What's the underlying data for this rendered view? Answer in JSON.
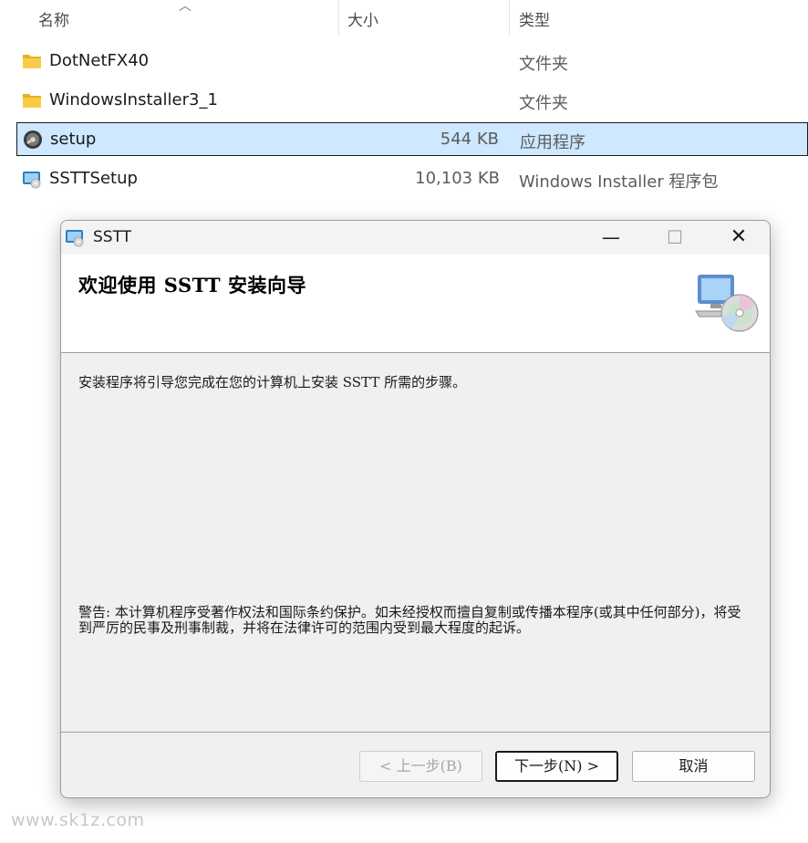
{
  "explorer": {
    "columns": {
      "name": "名称",
      "size": "大小",
      "type": "类型"
    },
    "files": [
      {
        "name": "DotNetFX40",
        "size": "",
        "type": "文件夹",
        "icon": "folder-icon"
      },
      {
        "name": "WindowsInstaller3_1",
        "size": "",
        "type": "文件夹",
        "icon": "folder-icon"
      },
      {
        "name": "setup",
        "size": "544 KB",
        "type": "应用程序",
        "icon": "setup-exe-icon",
        "selected": true
      },
      {
        "name": "SSTTSetup",
        "size": "10,103 KB",
        "type": "Windows Installer 程序包",
        "icon": "msi-package-icon"
      }
    ]
  },
  "dialog": {
    "title": "SSTT",
    "minimize": "—",
    "maximize": "☐",
    "close": "✕",
    "heading": "欢迎使用 SSTT 安装向导",
    "body": "安装程序将引导您完成在您的计算机上安装 SSTT 所需的步骤。",
    "warning": "警告: 本计算机程序受著作权法和国际条约保护。如未经授权而擅自复制或传播本程序(或其中任何部分)，将受到严厉的民事及刑事制裁，并将在法律许可的范围内受到最大程度的起诉。",
    "buttons": {
      "back": "< 上一步(B)",
      "next": "下一步(N) >",
      "cancel": "取消"
    }
  },
  "watermark": "www.sk1z.com",
  "colors": {
    "selection": "#cde8ff",
    "folder": "#f4c430",
    "dialog_bg": "#f0f0f0"
  }
}
